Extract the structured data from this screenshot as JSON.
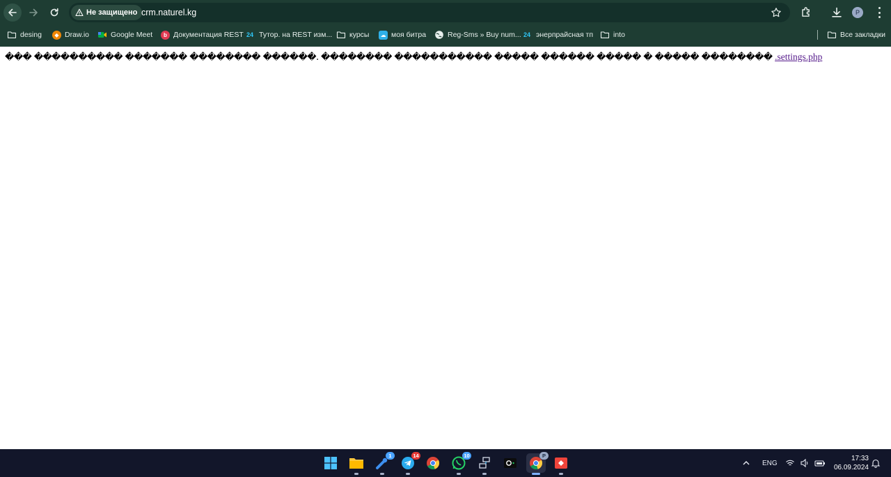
{
  "browser": {
    "security_chip": "Не защищено",
    "url": "crm.naturel.kg",
    "profile_initial": "P"
  },
  "bookmarks": [
    {
      "label": "desing",
      "icon": "folder-icon"
    },
    {
      "label": "Draw.io",
      "icon": "drawio-icon"
    },
    {
      "label": "Google Meet",
      "icon": "google-meet-icon"
    },
    {
      "label": "Документация REST",
      "icon": "bitrix-red-icon"
    },
    {
      "label": "Тутор. на REST изм...",
      "icon": "bitrix24-icon"
    },
    {
      "label": "курсы",
      "icon": "folder-icon"
    },
    {
      "label": "моя битра",
      "icon": "cloud-icon"
    },
    {
      "label": "Reg-Sms » Buy num...",
      "icon": "globe-icon"
    },
    {
      "label": "энерпрайсная тп",
      "icon": "bitrix24-icon"
    },
    {
      "label": "into",
      "icon": "folder-icon"
    }
  ],
  "all_bookmarks": "Все закладки",
  "page": {
    "garbled_text": "��� ���������� ������� �������� ������. �������� ����������� ����� ������ ����� � ����� ��������",
    "link_text": ".settings.php"
  },
  "taskbar": {
    "apps": [
      {
        "name": "windows-start-icon",
        "badge": ""
      },
      {
        "name": "file-explorer-icon",
        "badge": ""
      },
      {
        "name": "steam-icon",
        "badge": "1"
      },
      {
        "name": "telegram-icon",
        "badge": "14"
      },
      {
        "name": "chrome-icon",
        "badge": ""
      },
      {
        "name": "whatsapp-icon",
        "badge": "10"
      },
      {
        "name": "network-app-icon",
        "badge": ""
      },
      {
        "name": "terminal-icon",
        "badge": ""
      },
      {
        "name": "chrome-profile-icon",
        "badge": "P"
      },
      {
        "name": "anydesk-icon",
        "badge": ""
      }
    ],
    "language": "ENG",
    "time": "17:33",
    "date": "06.09.2024"
  },
  "colors": {
    "chrome_bg": "#1e3d33",
    "taskbar_bg": "#12162a",
    "link": "#551a8b"
  }
}
